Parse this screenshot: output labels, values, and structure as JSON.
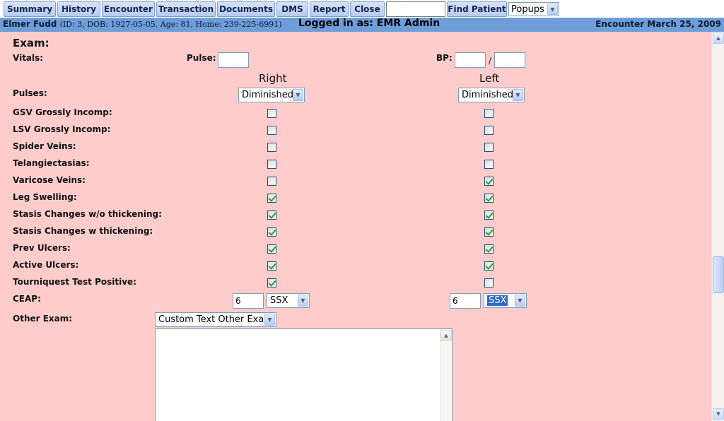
{
  "nav": {
    "buttons": [
      "Summary",
      "History",
      "Encounter",
      "Transaction",
      "Documents",
      "DMS",
      "Report",
      "Close"
    ],
    "search_value": "",
    "find_patient": "Find Patient",
    "popups": "Popups"
  },
  "banner": {
    "patient_name": "Elmer Fudd",
    "patient_info": "(ID: 3, DOB: 1927-05-05, Age: 81, Home: 239-225-6991)",
    "logged_in": "Logged in as: EMR Admin",
    "encounter": "Encounter March 25, 2009"
  },
  "exam": {
    "heading": "Exam:",
    "vitals_label": "Vitals:",
    "pulse_label": "Pulse:",
    "pulse_value": "",
    "bp_label": "BP:",
    "bp_systolic": "",
    "bp_separator": "/",
    "bp_diastolic": "",
    "right_header": "Right",
    "left_header": "Left",
    "pulses_label": "Pulses:",
    "pulses_right": "Diminished",
    "pulses_left": "Diminished",
    "rows": [
      {
        "label": "GSV Grossly Incomp:",
        "right": false,
        "left": false
      },
      {
        "label": "LSV Grossly Incomp:",
        "right": false,
        "left": false
      },
      {
        "label": "Spider Veins:",
        "right": false,
        "left": false
      },
      {
        "label": "Telangiectasias:",
        "right": false,
        "left": false
      },
      {
        "label": "Varicose Veins:",
        "right": false,
        "left": true
      },
      {
        "label": "Leg Swelling:",
        "right": true,
        "left": true
      },
      {
        "label": "Stasis Changes w/o thickening:",
        "right": true,
        "left": true
      },
      {
        "label": "Stasis Changes w thickening:",
        "right": true,
        "left": true
      },
      {
        "label": "Prev Ulcers:",
        "right": true,
        "left": true
      },
      {
        "label": "Active Ulcers:",
        "right": true,
        "left": true
      },
      {
        "label": "Tourniquest Test Positive:",
        "right": true,
        "left": false
      }
    ],
    "ceap_label": "CEAP:",
    "ceap_right_value": "6",
    "ceap_right_select": "SSX",
    "ceap_left_value": "6",
    "ceap_left_select": "SSX",
    "other_exam_label": "Other Exam:",
    "other_exam_select": "Custom Text Other Exam",
    "other_exam_text": ""
  },
  "colors": {
    "content_bg": "#ffcccc",
    "banner_bg": "#6e9ed8",
    "check_green": "#21a121"
  }
}
